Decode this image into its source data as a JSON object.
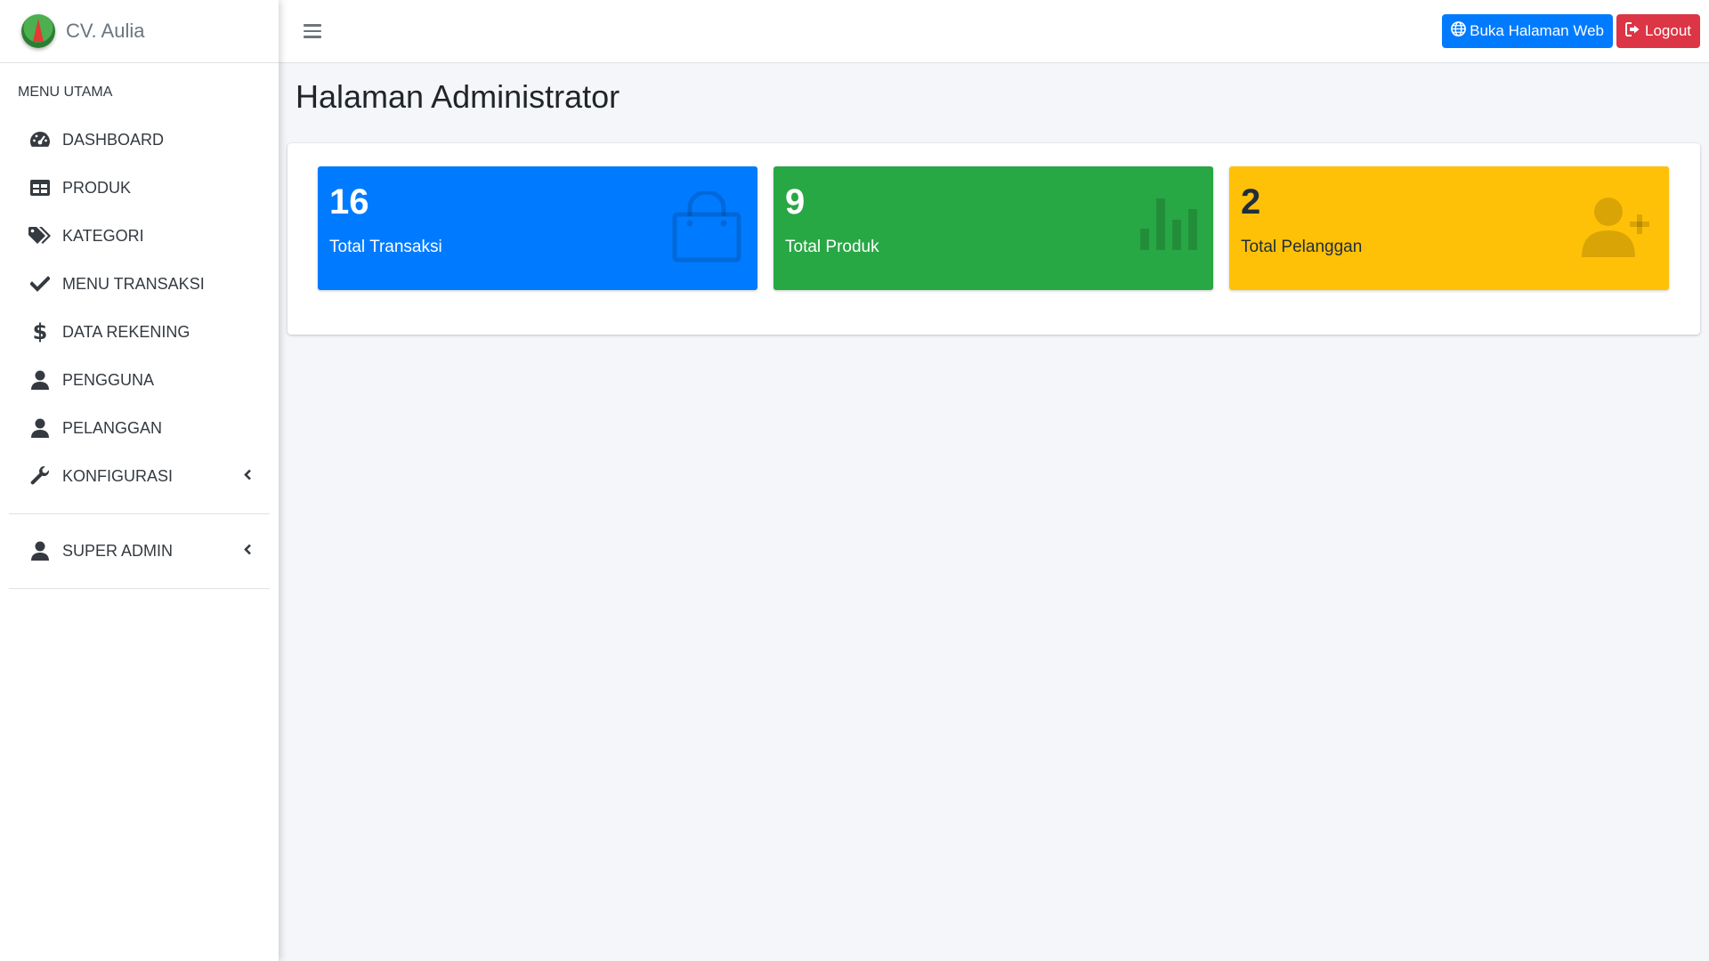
{
  "brand": {
    "name": "CV. Aulia"
  },
  "sidebar": {
    "header": "MENU UTAMA",
    "items": [
      {
        "label": "DASHBOARD",
        "icon": "tachometer-icon"
      },
      {
        "label": "PRODUK",
        "icon": "table-icon"
      },
      {
        "label": "KATEGORI",
        "icon": "tags-icon"
      },
      {
        "label": "MENU TRANSAKSI",
        "icon": "check-icon"
      },
      {
        "label": "DATA REKENING",
        "icon": "dollar-icon"
      },
      {
        "label": "PENGGUNA",
        "icon": "user-icon"
      },
      {
        "label": "PELANGGAN",
        "icon": "user-icon"
      },
      {
        "label": "KONFIGURASI",
        "icon": "wrench-icon",
        "has_submenu": true
      }
    ],
    "admin_item": {
      "label": "SUPER ADMIN",
      "icon": "user-icon",
      "has_submenu": true
    }
  },
  "topbar": {
    "open_web_label": "Buka Halaman Web",
    "logout_label": "Logout"
  },
  "main": {
    "title": "Halaman Administrator",
    "stats": [
      {
        "value": "16",
        "label": "Total Transaksi",
        "color": "#007bff",
        "icon": "shopping-bag-icon"
      },
      {
        "value": "9",
        "label": "Total Produk",
        "color": "#28a745",
        "icon": "bar-chart-icon"
      },
      {
        "value": "2",
        "label": "Total Pelanggan",
        "color": "#ffc107",
        "icon": "user-plus-icon"
      }
    ]
  },
  "colors": {
    "primary": "#007bff",
    "success": "#28a745",
    "warning": "#ffc107",
    "danger": "#dc3545"
  }
}
